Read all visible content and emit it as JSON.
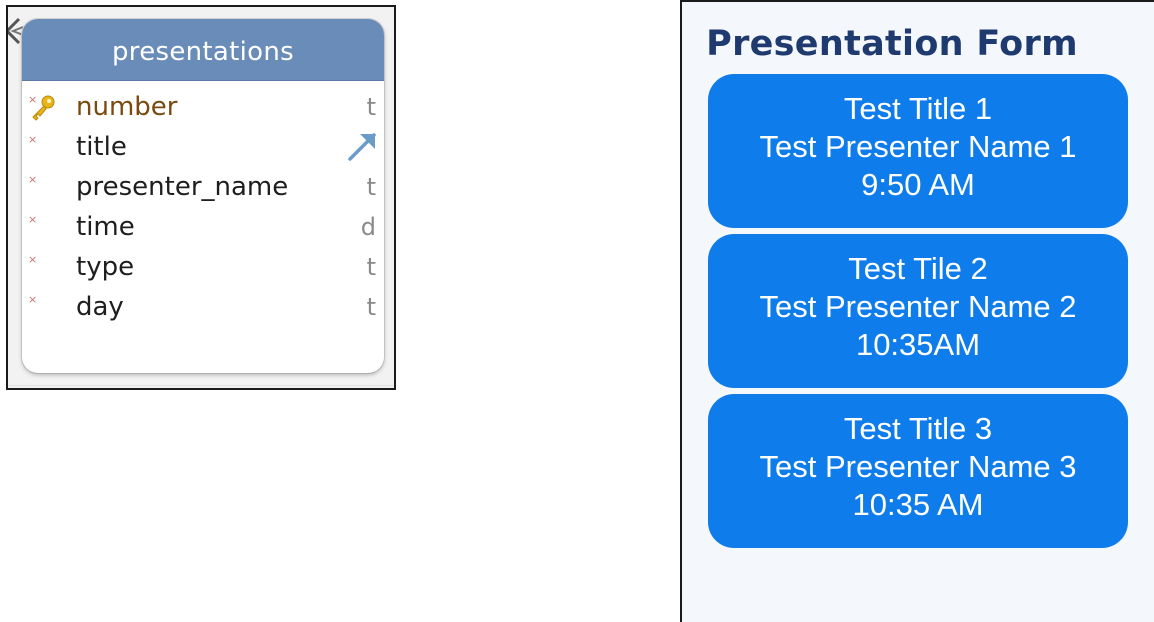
{
  "db_table": {
    "name": "presentations",
    "columns": [
      {
        "name": "number",
        "type": "t",
        "primary_key": true
      },
      {
        "name": "title",
        "type": "",
        "foreign_key": true
      },
      {
        "name": "presenter_name",
        "type": "t"
      },
      {
        "name": "time",
        "type": "d"
      },
      {
        "name": "type",
        "type": "t"
      },
      {
        "name": "day",
        "type": "t"
      }
    ],
    "colors": {
      "header": "#6a8cb8",
      "not_null_mark": "#d07070",
      "key_icon": "#e8b41a"
    },
    "icons": {
      "back": "chevron-left-icon",
      "primary_key": "key-icon",
      "foreign_key": "arrow-up-right-icon",
      "not_null": "asterisk-icon"
    },
    "not_null_glyph": "×"
  },
  "form": {
    "title": "Presentation Form",
    "colors": {
      "title": "#1f3a6e",
      "card": "#0f7ceb",
      "card_text": "#ffffff"
    },
    "cards": [
      {
        "title": "Test Title 1",
        "presenter": "Test Presenter Name 1",
        "time": "9:50 AM"
      },
      {
        "title": "Test Tile 2",
        "presenter": "Test Presenter Name 2",
        "time": "10:35AM"
      },
      {
        "title": "Test Title 3",
        "presenter": "Test Presenter Name 3",
        "time": "10:35 AM"
      }
    ]
  }
}
